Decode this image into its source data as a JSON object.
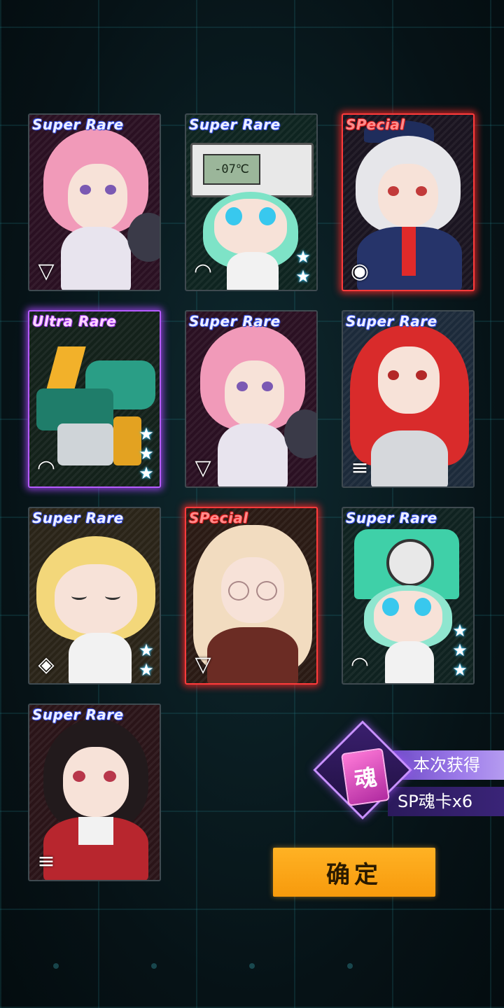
{
  "cards": [
    {
      "rarity": "Super Rare",
      "class_icon": "triangle-icon",
      "stars": 0
    },
    {
      "rarity": "Super Rare",
      "class_icon": "wifi-icon",
      "stars": 2,
      "device_text": "-07℃"
    },
    {
      "rarity": "SPecial",
      "class_icon": "drop-icon",
      "stars": 0
    },
    {
      "rarity": "Ultra Rare",
      "class_icon": "wifi-icon",
      "stars": 3
    },
    {
      "rarity": "Super Rare",
      "class_icon": "triangle-icon",
      "stars": 0
    },
    {
      "rarity": "Super Rare",
      "class_icon": "stripes-icon",
      "stars": 0
    },
    {
      "rarity": "Super Rare",
      "class_icon": "diamond-icon",
      "stars": 2
    },
    {
      "rarity": "SPecial",
      "class_icon": "triangle-icon",
      "stars": 0
    },
    {
      "rarity": "Super Rare",
      "class_icon": "wifi-icon",
      "stars": 3
    },
    {
      "rarity": "Super Rare",
      "class_icon": "stripes-icon",
      "stars": 0
    }
  ],
  "reward": {
    "card_glyph": "魂",
    "title": "本次获得",
    "amount": "SP魂卡x6"
  },
  "confirm_label": "确定",
  "colors": {
    "super_rare_label": "#eef0ff",
    "ultra_rare_glow": "#b65cff",
    "special_glow": "#ff3b3b",
    "confirm_button": "#f7a514",
    "reward_purple": "#8b68de"
  }
}
